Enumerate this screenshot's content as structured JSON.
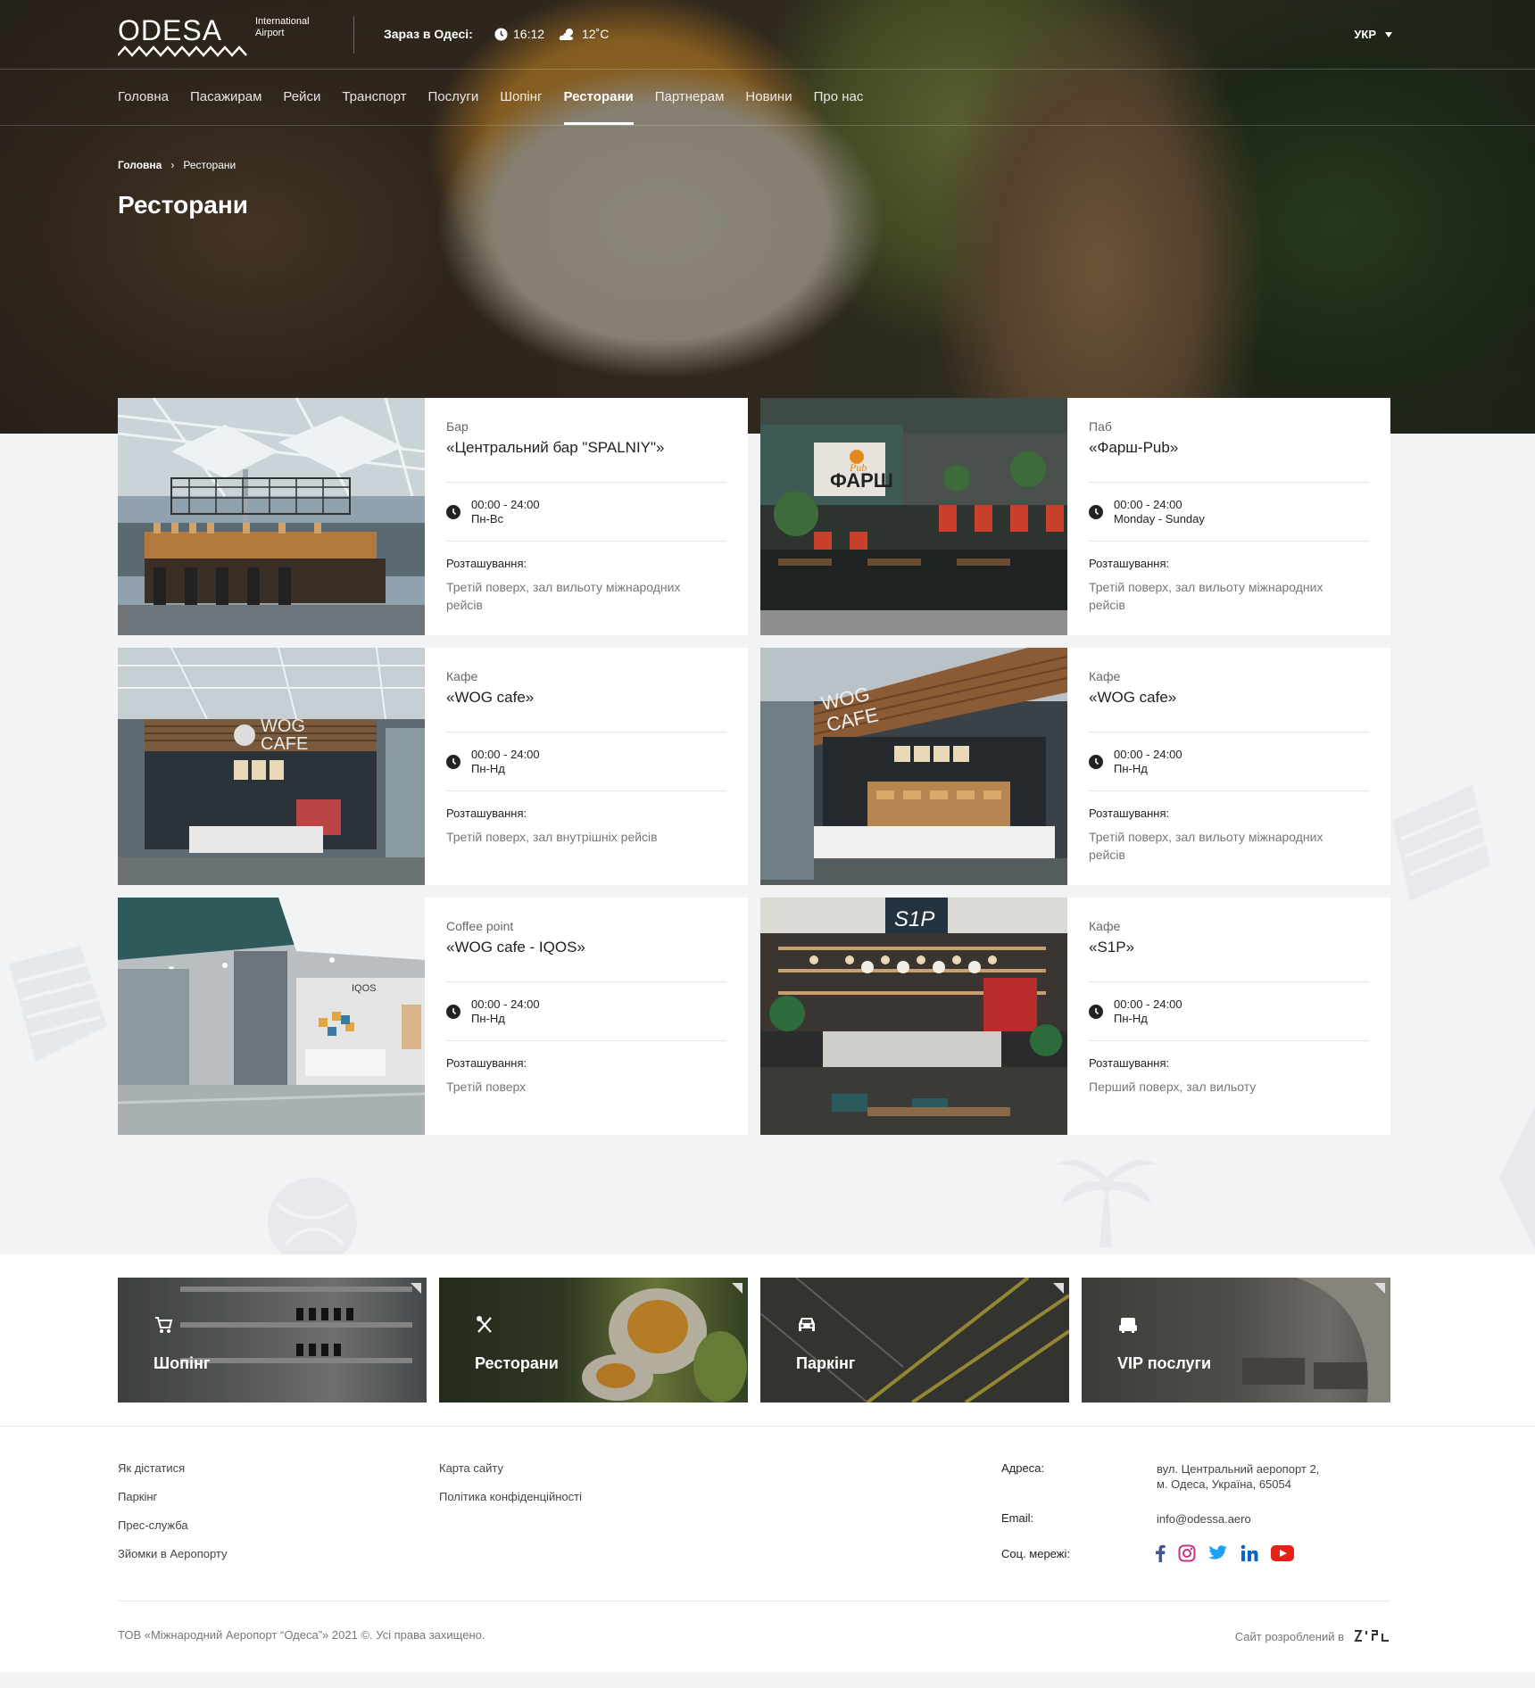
{
  "header": {
    "logo_word": "ODESA",
    "logo_sub": "International Airport",
    "now_label": "Зараз в Одесі:",
    "time": "16:12",
    "temperature": "12˚C",
    "language": "УКР"
  },
  "nav": [
    {
      "label": "Головна"
    },
    {
      "label": "Пасажирам"
    },
    {
      "label": "Рейси"
    },
    {
      "label": "Транспорт"
    },
    {
      "label": "Послуги"
    },
    {
      "label": "Шопінг"
    },
    {
      "label": "Ресторани",
      "active": true
    },
    {
      "label": "Партнерам"
    },
    {
      "label": "Новини"
    },
    {
      "label": "Про нас"
    }
  ],
  "breadcrumb": {
    "home": "Головна",
    "sep": "›",
    "current": "Ресторани"
  },
  "page_title": "Ресторани",
  "cards": [
    {
      "type": "Бар",
      "name": "«Центральний бар \"SPALNIY\"»",
      "hours": "00:00 - 24:00",
      "days": "Пн-Вс",
      "location_label": "Розташування:",
      "location": "Третій поверх, зал вильоту міжнародних рейсів"
    },
    {
      "type": "Паб",
      "name": "«Фарш-Pub»",
      "hours": "00:00 - 24:00",
      "days": "Monday - Sunday",
      "location_label": "Розташування:",
      "location": "Третій поверх, зал вильоту міжнародних рейсів"
    },
    {
      "type": "Кафе",
      "name": "«WOG cafe»",
      "hours": "00:00 - 24:00",
      "days": "Пн-Нд",
      "location_label": "Розташування:",
      "location": "Третій поверх, зал внутрішніх рейсів"
    },
    {
      "type": "Кафе",
      "name": "«WOG cafe»",
      "hours": "00:00 - 24:00",
      "days": "Пн-Нд",
      "location_label": "Розташування:",
      "location": "Третій поверх, зал вильоту міжнародних рейсів"
    },
    {
      "type": "Coffee point",
      "name": "«WOG cafe - IQOS»",
      "hours": "00:00 - 24:00",
      "days": "Пн-Нд",
      "location_label": "Розташування:",
      "location": "Третій поверх"
    },
    {
      "type": "Кафе",
      "name": "«S1P»",
      "hours": "00:00 - 24:00",
      "days": "Пн-Нд",
      "location_label": "Розташування:",
      "location": "Перший поверх, зал вильоту"
    }
  ],
  "photo_texts": {
    "farsh": "ФАРШ",
    "pub": "Pub",
    "wog1": "WOG",
    "cafe1": "CAFE",
    "wog2": "WOG",
    "cafe2": "CAFE",
    "iqos": "IQOS",
    "s1p": "S1P"
  },
  "tiles": [
    {
      "label": "Шопінг",
      "icon": "cart-icon"
    },
    {
      "label": "Ресторани",
      "icon": "cutlery-icon"
    },
    {
      "label": "Паркінг",
      "icon": "car-icon"
    },
    {
      "label": "VIP послуги",
      "icon": "sofa-icon"
    }
  ],
  "footer": {
    "links_col1": [
      "Як дістатися",
      "Паркінг",
      "Прес-служба",
      "Зйомки в Аеропорту"
    ],
    "links_col2": [
      "Карта сайту",
      "Політика конфіденційності"
    ],
    "address_label": "Адреса:",
    "address_line1": "вул. Центральний аеропорт 2,",
    "address_line2": "м. Одеса, Україна, 65054",
    "email_label": "Email:",
    "email": "info@odessa.aero",
    "social_label": "Соц. мережі:",
    "socials": [
      "facebook-icon",
      "instagram-icon",
      "twitter-icon",
      "linkedin-icon",
      "youtube-icon"
    ],
    "copyright": "ТОВ «Міжнародний Аеропорт “Одеса”» 2021 ©. Усі права захищено.",
    "developer": "Сайт розроблений в"
  },
  "colors": {
    "accent": "#ffffff",
    "facebook": "#3b5998",
    "instagram": "#c13584",
    "twitter": "#1da1f2",
    "linkedin": "#0a66c2",
    "youtube": "#e62117"
  }
}
